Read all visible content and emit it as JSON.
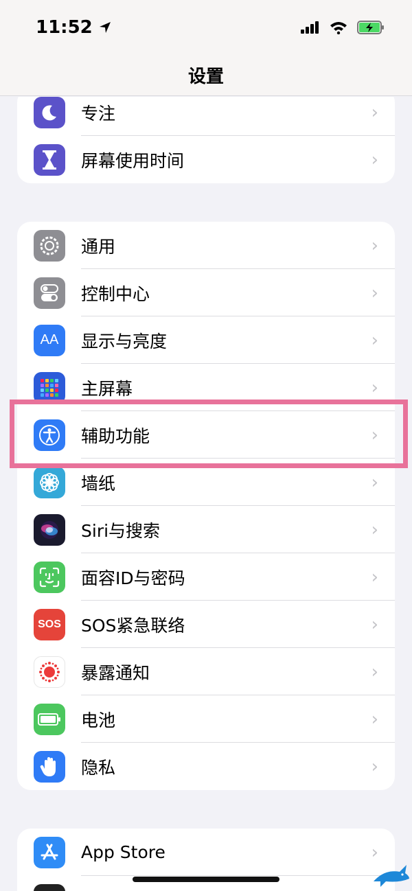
{
  "status": {
    "time": "11:52"
  },
  "nav": {
    "title": "设置"
  },
  "groups": [
    {
      "items": [
        {
          "label": "专注",
          "icon": "moon-icon",
          "color": "#5b52c9"
        },
        {
          "label": "屏幕使用时间",
          "icon": "hourglass-icon",
          "color": "#5b52c9"
        }
      ]
    },
    {
      "items": [
        {
          "label": "通用",
          "icon": "gear-icon",
          "color": "#8e8e93"
        },
        {
          "label": "控制中心",
          "icon": "toggles-icon",
          "color": "#8e8e93"
        },
        {
          "label": "显示与亮度",
          "icon": "text-size-icon",
          "color": "#2f7bf6"
        },
        {
          "label": "主屏幕",
          "icon": "app-grid-icon",
          "color": "#2c5bd9"
        },
        {
          "label": "辅助功能",
          "icon": "accessibility-icon",
          "color": "#2f7bf6"
        },
        {
          "label": "墙纸",
          "icon": "flower-icon",
          "color": "#34a8d8"
        },
        {
          "label": "Siri与搜索",
          "icon": "siri-icon",
          "color": "#1a1a2e"
        },
        {
          "label": "面容ID与密码",
          "icon": "face-id-icon",
          "color": "#4cc75e"
        },
        {
          "label": "SOS紧急联络",
          "icon": "sos-icon",
          "color": "#e5443a"
        },
        {
          "label": "暴露通知",
          "icon": "exposure-icon",
          "color": "#ffffff"
        },
        {
          "label": "电池",
          "icon": "battery-icon",
          "color": "#4cc75e"
        },
        {
          "label": "隐私",
          "icon": "hand-icon",
          "color": "#2f7bf6"
        }
      ]
    },
    {
      "items": [
        {
          "label": "App Store",
          "icon": "app-store-icon",
          "color": "#2f8cf6"
        }
      ]
    }
  ],
  "sos_text": "SOS",
  "aa_text": "AA"
}
